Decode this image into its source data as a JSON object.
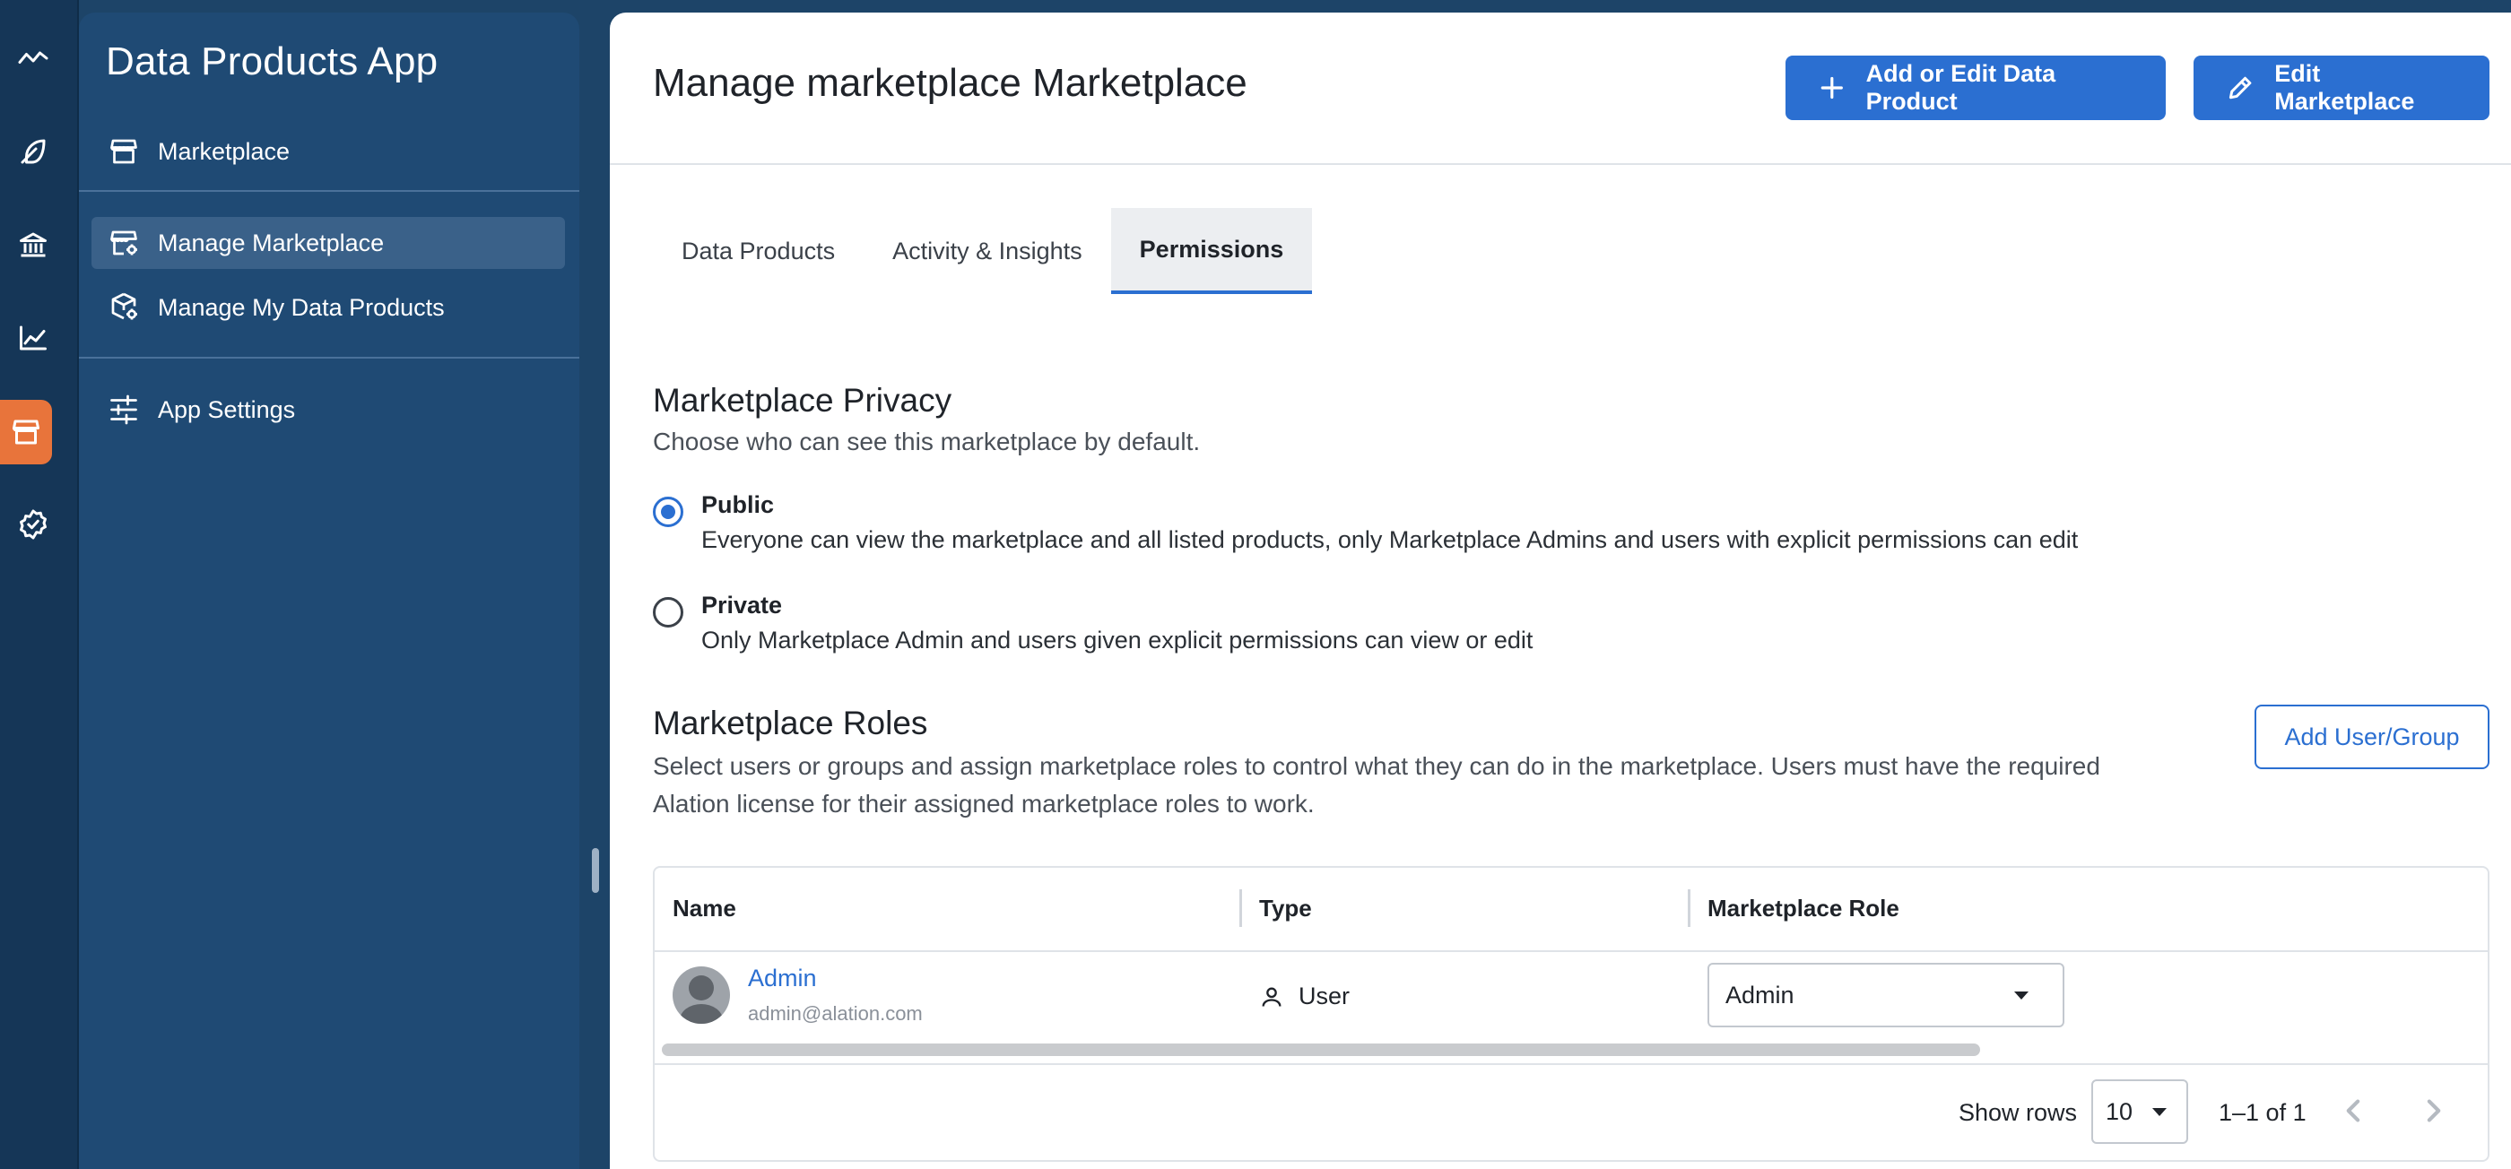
{
  "rail": {
    "icons": [
      "trend-icon",
      "feather-icon",
      "bank-icon",
      "chart-icon",
      "store-icon",
      "badge-check-icon"
    ],
    "active_index": 4
  },
  "sidebar": {
    "title": "Data Products App",
    "items": [
      {
        "label": "Marketplace",
        "icon": "store-icon"
      },
      {
        "label": "Manage Marketplace",
        "icon": "store-gear-icon",
        "selected": true
      },
      {
        "label": "Manage My Data Products",
        "icon": "box-gear-icon"
      },
      {
        "label": "App Settings",
        "icon": "sliders-icon"
      }
    ]
  },
  "header": {
    "title": "Manage marketplace Marketplace",
    "add_edit_label": "Add or Edit Data Product",
    "edit_marketplace_label": "Edit Marketplace"
  },
  "tabs": [
    {
      "label": "Data Products"
    },
    {
      "label": "Activity & Insights"
    },
    {
      "label": "Permissions",
      "active": true
    }
  ],
  "privacy": {
    "title": "Marketplace Privacy",
    "subtitle": "Choose who can see this marketplace by default.",
    "options": [
      {
        "label": "Public",
        "description": "Everyone can view the marketplace and all listed products, only Marketplace Admins and users with explicit permissions can edit",
        "checked": true
      },
      {
        "label": "Private",
        "description": "Only Marketplace Admin and users given explicit permissions can view or edit",
        "checked": false
      }
    ]
  },
  "roles": {
    "title": "Marketplace Roles",
    "subtitle_line1": "Select users or groups and assign marketplace roles to control what they can do in the marketplace. Users must have the required",
    "subtitle_line2": "Alation license for their assigned marketplace roles to work.",
    "add_button": "Add User/Group",
    "columns": [
      "Name",
      "Type",
      "Marketplace Role"
    ],
    "rows": [
      {
        "name": "Admin",
        "email": "admin@alation.com",
        "type": "User",
        "role": "Admin"
      }
    ],
    "footer": {
      "show_rows_label": "Show rows",
      "rows_per_page": "10",
      "page_info": "1–1 of 1"
    }
  },
  "colors": {
    "accent": "#2b6fd1",
    "rail_active": "#e8743b",
    "sidebar_bg": "#1f4a74"
  }
}
